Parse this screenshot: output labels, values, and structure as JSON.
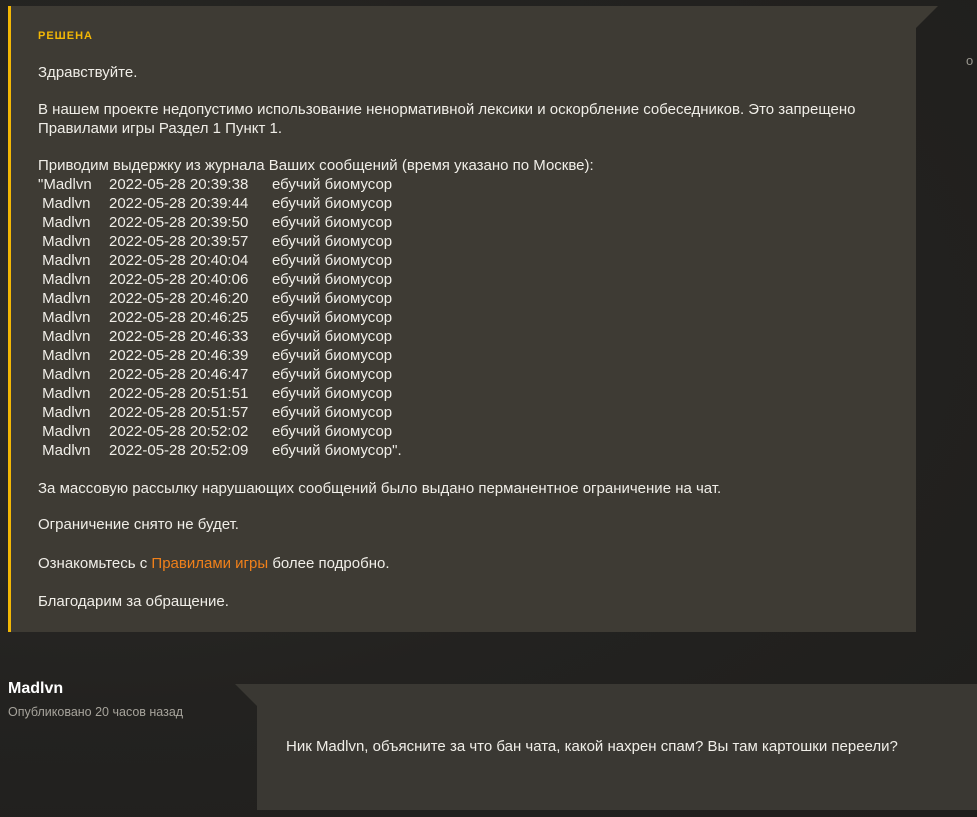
{
  "reply": {
    "status": "РЕШЕНА",
    "greeting": "Здравствуйте.",
    "rules_para": "В нашем проекте недопустимо использование ненормативной лексики и оскорбление собеседников. Это запрещено Правилами игры Раздел 1 Пункт 1.",
    "log_intro": "Приводим выдержку из журнала Ваших сообщений (время указано по Москве):",
    "log": [
      {
        "user": "\"Madlvn",
        "time": "2022-05-28 20:39:38",
        "msg": "ебучий биомусор"
      },
      {
        "user": " Madlvn",
        "time": "2022-05-28 20:39:44",
        "msg": "ебучий биомусор"
      },
      {
        "user": " Madlvn",
        "time": "2022-05-28 20:39:50",
        "msg": "ебучий биомусор"
      },
      {
        "user": " Madlvn",
        "time": "2022-05-28 20:39:57",
        "msg": "ебучий биомусор"
      },
      {
        "user": " Madlvn",
        "time": "2022-05-28 20:40:04",
        "msg": "ебучий биомусор"
      },
      {
        "user": " Madlvn",
        "time": "2022-05-28 20:40:06",
        "msg": "ебучий биомусор"
      },
      {
        "user": " Madlvn",
        "time": "2022-05-28 20:46:20",
        "msg": "ебучий биомусор"
      },
      {
        "user": " Madlvn",
        "time": "2022-05-28 20:46:25",
        "msg": "ебучий биомусор"
      },
      {
        "user": " Madlvn",
        "time": "2022-05-28 20:46:33",
        "msg": "ебучий биомусор"
      },
      {
        "user": " Madlvn",
        "time": "2022-05-28 20:46:39",
        "msg": "ебучий биомусор"
      },
      {
        "user": " Madlvn",
        "time": "2022-05-28 20:46:47",
        "msg": "ебучий биомусор"
      },
      {
        "user": " Madlvn",
        "time": "2022-05-28 20:51:51",
        "msg": "ебучий биомусор"
      },
      {
        "user": " Madlvn",
        "time": "2022-05-28 20:51:57",
        "msg": "ебучий биомусор"
      },
      {
        "user": " Madlvn",
        "time": "2022-05-28 20:52:02",
        "msg": "ебучий биомусор"
      },
      {
        "user": " Madlvn",
        "time": "2022-05-28 20:52:09",
        "msg": "ебучий биомусор\"."
      }
    ],
    "penalty": "За массовую рассылку нарушающих сообщений было выдано перманентное ограничение на чат.",
    "lift": "Ограничение снято не будет.",
    "read_prefix": "Ознакомьтесь с ",
    "read_link": "Правилами игры",
    "read_suffix": " более подробно.",
    "thanks": "Благодарим за обращение."
  },
  "side_fragment": "о",
  "user_post": {
    "author": "Madlvn",
    "meta": "Опубликовано 20 часов назад",
    "text": "Ник Madlvn, объясните за что бан чата, какой нахрен спам? Вы там картошки переели?"
  },
  "colors": {
    "accent": "#f2b705",
    "link": "#f0801a",
    "card": "#3e3b34",
    "background": "#242320"
  }
}
